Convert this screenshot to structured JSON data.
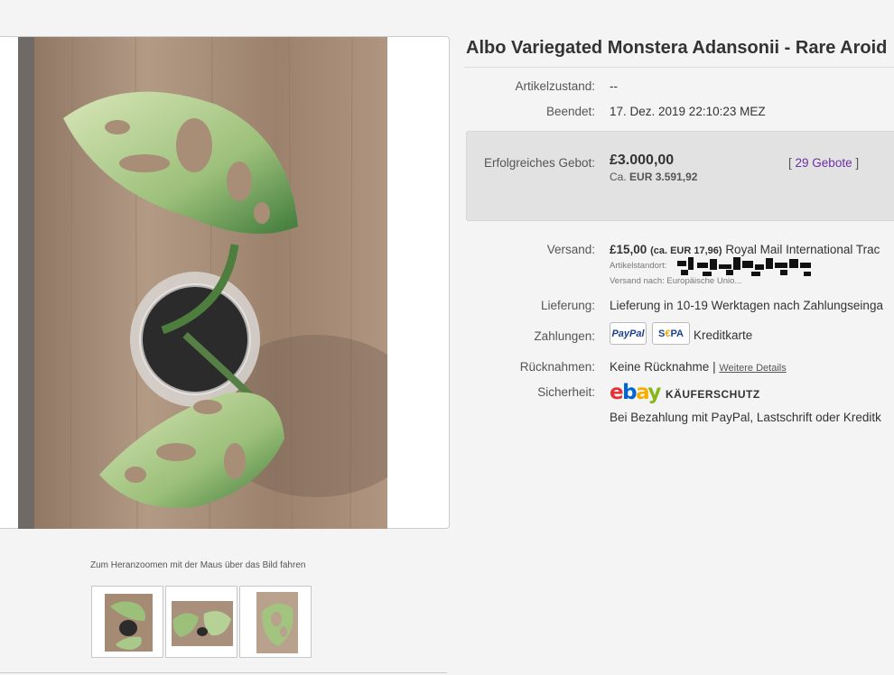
{
  "listing": {
    "title": "Albo Variegated Monstera Adansonii - Rare Aroid",
    "zoom_hint": "Zum Heranzoomen mit der Maus über das Bild fahren",
    "thumbnails": [
      "plant-top-view",
      "plant-leaves-side",
      "plant-leaf-closeup"
    ]
  },
  "details": {
    "condition_label": "Artikelzustand:",
    "condition_value": "--",
    "ended_label": "Beendet:",
    "ended_value": "17. Dez. 2019  22:10:23 MEZ",
    "bid_label": "Erfolgreiches Gebot:",
    "bid_price": "£3.000,00",
    "bid_conv_prefix": "Ca.",
    "bid_conv_value": "EUR 3.591,92",
    "bids_open": "[",
    "bids_link": "29 Gebote",
    "bids_close": "]",
    "shipping_label": "Versand:",
    "shipping_price": "£15,00",
    "shipping_conv": "(ca. EUR 17,96)",
    "shipping_service": "Royal Mail International Trac",
    "item_location": "Artikelstandort:",
    "ships_to": "Versand nach: Europäische Unio...",
    "delivery_label": "Lieferung:",
    "delivery_value": "Lieferung in 10-19 Werktagen nach Zahlungseinga",
    "payments_label": "Zahlungen:",
    "paypal_badge": "PayPal",
    "sepa_badge_s": "S",
    "sepa_badge_e": "€",
    "sepa_badge_pa": "PA",
    "credit_card": "Kreditkarte",
    "returns_label": "Rücknahmen:",
    "returns_value": "Keine Rücknahme |",
    "returns_link": "Weitere Details",
    "security_label": "Sicherheit:",
    "ebay_e": "e",
    "ebay_b": "b",
    "ebay_a": "a",
    "ebay_y": "y",
    "buyer_protection": "KÄUFERSCHUTZ",
    "security_note": "Bei Bezahlung mit PayPal, Lastschrift oder Kreditk"
  },
  "colors": {
    "link": "#6b2fa3",
    "bid_box": "#e2e2e2",
    "background": "#f4f4f4"
  }
}
